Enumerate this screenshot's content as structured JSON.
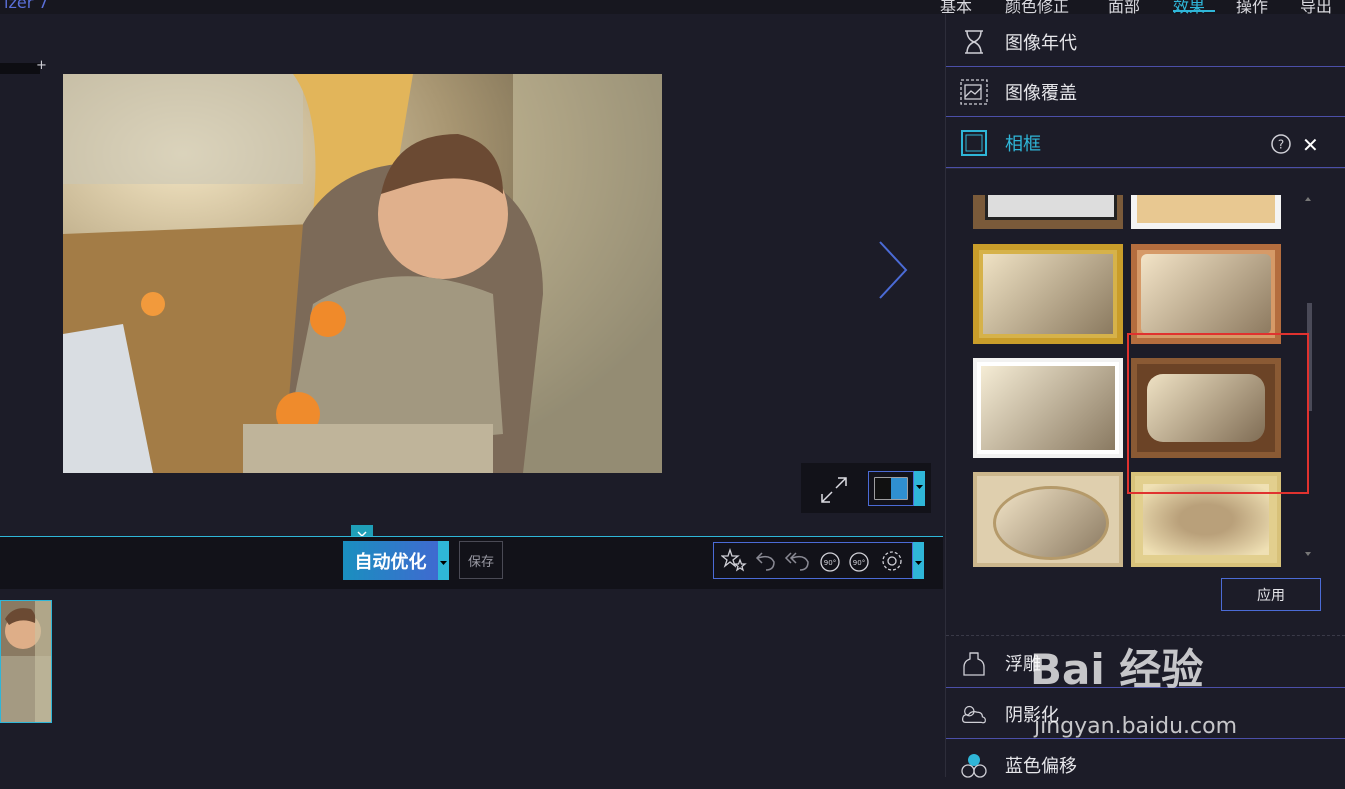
{
  "app": {
    "title_fragment": "izer 7"
  },
  "top_tabs": [
    {
      "label": "基本"
    },
    {
      "label": "颜色修正"
    },
    {
      "label": "面部"
    },
    {
      "label": "效果",
      "active": true
    },
    {
      "label": "操作"
    },
    {
      "label": "导出"
    }
  ],
  "viewer": {
    "photo_alt": "mother and baby peeling tangerines",
    "ruler_plus": "+"
  },
  "action_bar": {
    "auto_optimize_label": "自动优化",
    "save_label": "保存",
    "rotate_left_label": "90°",
    "rotate_right_label": "90°"
  },
  "right_panel": {
    "items": [
      {
        "label": "图像年代",
        "icon": "hourglass-icon"
      },
      {
        "label": "图像覆盖",
        "icon": "image-overlay-icon"
      },
      {
        "label": "相框",
        "icon": "frame-icon",
        "active": true
      },
      {
        "label": "浮雕",
        "icon": "emboss-icon"
      },
      {
        "label": "阴影化",
        "icon": "shadow-cloud-icon"
      },
      {
        "label": "蓝色偏移",
        "icon": "blue-shift-icon"
      }
    ],
    "help_glyph": "?",
    "close_glyph": "✕",
    "apply_label": "应用",
    "frames": [
      {
        "style": "dark-wood"
      },
      {
        "style": "white"
      },
      {
        "style": "gold-ornate"
      },
      {
        "style": "burnt-edge"
      },
      {
        "style": "white-curl"
      },
      {
        "style": "carved-wood",
        "selected": true
      },
      {
        "style": "oval-cream"
      },
      {
        "style": "yellow-vignette"
      }
    ]
  },
  "watermark": {
    "logo": "Bai 经验",
    "url": "jingyan.baidu.com"
  },
  "colors": {
    "accent": "#2fb6d8",
    "highlight": "#e0322f",
    "panel_border": "#4b4fa8"
  }
}
